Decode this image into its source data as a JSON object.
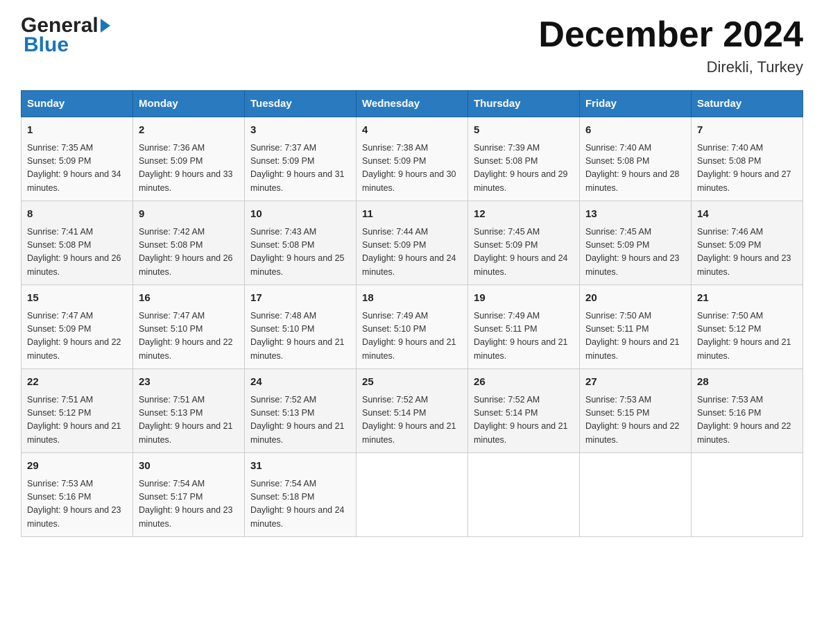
{
  "header": {
    "logo_general": "General",
    "logo_blue": "Blue",
    "title": "December 2024",
    "subtitle": "Direkli, Turkey"
  },
  "days_of_week": [
    "Sunday",
    "Monday",
    "Tuesday",
    "Wednesday",
    "Thursday",
    "Friday",
    "Saturday"
  ],
  "weeks": [
    [
      {
        "num": "1",
        "sunrise": "7:35 AM",
        "sunset": "5:09 PM",
        "daylight": "9 hours and 34 minutes."
      },
      {
        "num": "2",
        "sunrise": "7:36 AM",
        "sunset": "5:09 PM",
        "daylight": "9 hours and 33 minutes."
      },
      {
        "num": "3",
        "sunrise": "7:37 AM",
        "sunset": "5:09 PM",
        "daylight": "9 hours and 31 minutes."
      },
      {
        "num": "4",
        "sunrise": "7:38 AM",
        "sunset": "5:09 PM",
        "daylight": "9 hours and 30 minutes."
      },
      {
        "num": "5",
        "sunrise": "7:39 AM",
        "sunset": "5:08 PM",
        "daylight": "9 hours and 29 minutes."
      },
      {
        "num": "6",
        "sunrise": "7:40 AM",
        "sunset": "5:08 PM",
        "daylight": "9 hours and 28 minutes."
      },
      {
        "num": "7",
        "sunrise": "7:40 AM",
        "sunset": "5:08 PM",
        "daylight": "9 hours and 27 minutes."
      }
    ],
    [
      {
        "num": "8",
        "sunrise": "7:41 AM",
        "sunset": "5:08 PM",
        "daylight": "9 hours and 26 minutes."
      },
      {
        "num": "9",
        "sunrise": "7:42 AM",
        "sunset": "5:08 PM",
        "daylight": "9 hours and 26 minutes."
      },
      {
        "num": "10",
        "sunrise": "7:43 AM",
        "sunset": "5:08 PM",
        "daylight": "9 hours and 25 minutes."
      },
      {
        "num": "11",
        "sunrise": "7:44 AM",
        "sunset": "5:09 PM",
        "daylight": "9 hours and 24 minutes."
      },
      {
        "num": "12",
        "sunrise": "7:45 AM",
        "sunset": "5:09 PM",
        "daylight": "9 hours and 24 minutes."
      },
      {
        "num": "13",
        "sunrise": "7:45 AM",
        "sunset": "5:09 PM",
        "daylight": "9 hours and 23 minutes."
      },
      {
        "num": "14",
        "sunrise": "7:46 AM",
        "sunset": "5:09 PM",
        "daylight": "9 hours and 23 minutes."
      }
    ],
    [
      {
        "num": "15",
        "sunrise": "7:47 AM",
        "sunset": "5:09 PM",
        "daylight": "9 hours and 22 minutes."
      },
      {
        "num": "16",
        "sunrise": "7:47 AM",
        "sunset": "5:10 PM",
        "daylight": "9 hours and 22 minutes."
      },
      {
        "num": "17",
        "sunrise": "7:48 AM",
        "sunset": "5:10 PM",
        "daylight": "9 hours and 21 minutes."
      },
      {
        "num": "18",
        "sunrise": "7:49 AM",
        "sunset": "5:10 PM",
        "daylight": "9 hours and 21 minutes."
      },
      {
        "num": "19",
        "sunrise": "7:49 AM",
        "sunset": "5:11 PM",
        "daylight": "9 hours and 21 minutes."
      },
      {
        "num": "20",
        "sunrise": "7:50 AM",
        "sunset": "5:11 PM",
        "daylight": "9 hours and 21 minutes."
      },
      {
        "num": "21",
        "sunrise": "7:50 AM",
        "sunset": "5:12 PM",
        "daylight": "9 hours and 21 minutes."
      }
    ],
    [
      {
        "num": "22",
        "sunrise": "7:51 AM",
        "sunset": "5:12 PM",
        "daylight": "9 hours and 21 minutes."
      },
      {
        "num": "23",
        "sunrise": "7:51 AM",
        "sunset": "5:13 PM",
        "daylight": "9 hours and 21 minutes."
      },
      {
        "num": "24",
        "sunrise": "7:52 AM",
        "sunset": "5:13 PM",
        "daylight": "9 hours and 21 minutes."
      },
      {
        "num": "25",
        "sunrise": "7:52 AM",
        "sunset": "5:14 PM",
        "daylight": "9 hours and 21 minutes."
      },
      {
        "num": "26",
        "sunrise": "7:52 AM",
        "sunset": "5:14 PM",
        "daylight": "9 hours and 21 minutes."
      },
      {
        "num": "27",
        "sunrise": "7:53 AM",
        "sunset": "5:15 PM",
        "daylight": "9 hours and 22 minutes."
      },
      {
        "num": "28",
        "sunrise": "7:53 AM",
        "sunset": "5:16 PM",
        "daylight": "9 hours and 22 minutes."
      }
    ],
    [
      {
        "num": "29",
        "sunrise": "7:53 AM",
        "sunset": "5:16 PM",
        "daylight": "9 hours and 23 minutes."
      },
      {
        "num": "30",
        "sunrise": "7:54 AM",
        "sunset": "5:17 PM",
        "daylight": "9 hours and 23 minutes."
      },
      {
        "num": "31",
        "sunrise": "7:54 AM",
        "sunset": "5:18 PM",
        "daylight": "9 hours and 24 minutes."
      },
      null,
      null,
      null,
      null
    ]
  ]
}
